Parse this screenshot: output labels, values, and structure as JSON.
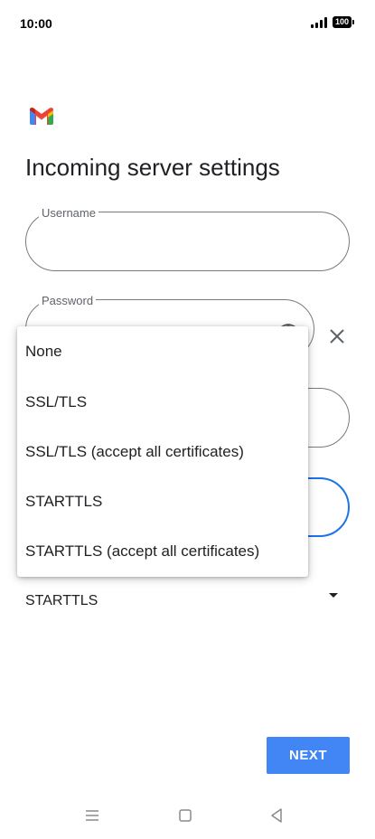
{
  "status_bar": {
    "time": "10:00",
    "battery": "100"
  },
  "page": {
    "title": "Incoming server settings"
  },
  "fields": {
    "username_label": "Username",
    "password_label": "Password"
  },
  "security": {
    "selected": "STARTTLS"
  },
  "dropdown": {
    "options": [
      "None",
      "SSL/TLS",
      "SSL/TLS (accept all certificates)",
      "STARTTLS",
      "STARTTLS (accept all certificates)"
    ]
  },
  "actions": {
    "next_label": "NEXT"
  },
  "colors": {
    "accent": "#4285f4",
    "focus_border": "#1a73e8"
  },
  "icons": [
    "gmail-logo",
    "visibility-icon",
    "close-icon",
    "dropdown-arrow-icon",
    "menu-nav-icon",
    "home-nav-icon",
    "back-nav-icon"
  ]
}
